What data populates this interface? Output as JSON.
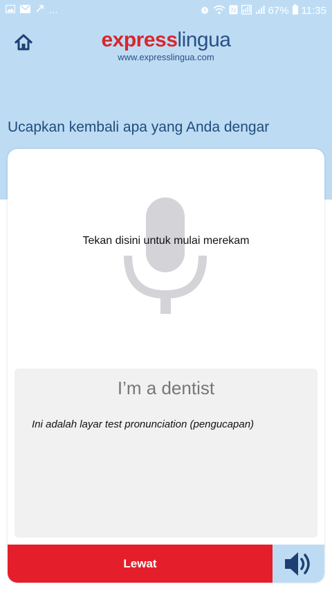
{
  "status_bar": {
    "battery": "67%",
    "time": "11:35",
    "icons": [
      "image-icon",
      "mail-icon",
      "missed-call-icon",
      "more-icon",
      "alarm-icon",
      "wifi-icon",
      "nfc-icon",
      "data-icon",
      "signal-icon",
      "battery-icon"
    ]
  },
  "header": {
    "logo_part1": "express",
    "logo_part2": "lingua",
    "logo_url": "www.expresslingua.com",
    "home_icon": "home-icon"
  },
  "instruction": "Ucapkan kembali apa yang Anda dengar",
  "card": {
    "mic_icon": "microphone-icon",
    "record_hint": "Tekan disini untuk mulai merekam",
    "phrase": "I’m a dentist",
    "explanation": "Ini adalah layar test pronunciation (pengucapan)",
    "skip_label": "Lewat",
    "audio_icon": "speaker-icon"
  },
  "colors": {
    "header_bg": "#bddcf4",
    "brand_blue": "#2a4f86",
    "brand_red": "#d8262c",
    "skip_red": "#e41f2b",
    "mic_gray": "#d3d3d8",
    "panel_gray": "#f1f1f1"
  }
}
